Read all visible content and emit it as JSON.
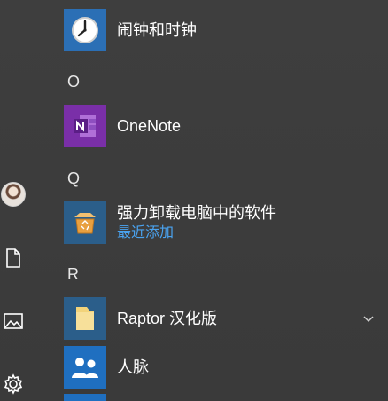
{
  "start_menu": {
    "apps": [
      {
        "id": "alarms",
        "label": "闹钟和时钟",
        "tile_color": "#2b6fb5",
        "icon": "clock-icon"
      },
      {
        "id": "onenote",
        "label": "OneNote",
        "tile_color": "#7a2fa8",
        "icon": "onenote-icon"
      },
      {
        "id": "uninstaller",
        "label": "强力卸载电脑中的软件",
        "sublabel": "最近添加",
        "tile_color": "#2b5e8a",
        "icon": "recycle-box-icon"
      },
      {
        "id": "raptor",
        "label": "Raptor 汉化版",
        "tile_color": "#2b5e8a",
        "icon": "folder-icon"
      },
      {
        "id": "people",
        "label": "人脉",
        "tile_color": "#1f6fc0",
        "icon": "people-icon"
      }
    ],
    "letters": [
      "O",
      "Q",
      "R"
    ],
    "accent": "#4aa3f0"
  },
  "rail": {
    "items": [
      "avatar",
      "documents-icon",
      "pictures-icon",
      "settings-icon"
    ]
  }
}
